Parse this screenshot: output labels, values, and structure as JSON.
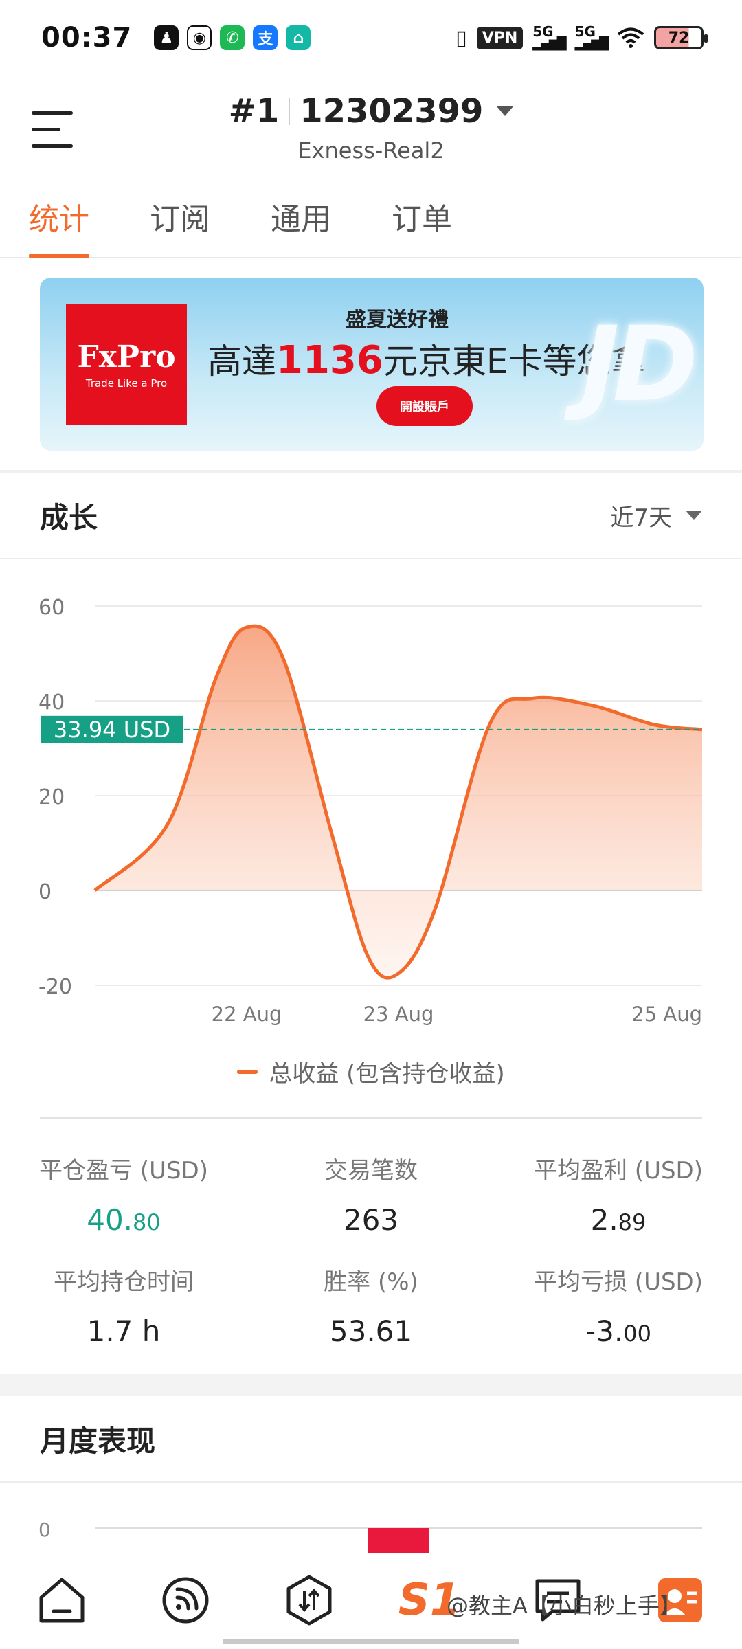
{
  "status_bar": {
    "time": "00:37",
    "vpn_label": "VPN",
    "network_1": "5G",
    "network_2": "5G",
    "battery": "72"
  },
  "header": {
    "rank": "#1",
    "account_number": "12302399",
    "server": "Exness-Real2"
  },
  "tabs": [
    {
      "label": "统计",
      "active": true
    },
    {
      "label": "订阅",
      "active": false
    },
    {
      "label": "通用",
      "active": false
    },
    {
      "label": "订单",
      "active": false
    }
  ],
  "banner": {
    "brand": "FxPro",
    "brand_tagline": "Trade Like a Pro",
    "headline_small": "盛夏送好禮",
    "headline_prefix": "高達",
    "headline_amount": "1136",
    "headline_suffix": "元京東E卡等您拿",
    "cta": "開設賬戶",
    "mark": "JD"
  },
  "growth": {
    "title": "成长",
    "range": "近7天",
    "current_value_label": "33.94 USD",
    "legend": "总收益 (包含持仓收益)"
  },
  "chart_data": {
    "type": "area",
    "series": [
      {
        "name": "总收益 (包含持仓收益)",
        "color": "#f26b2d",
        "points": [
          {
            "t": 0.0,
            "y": 0
          },
          {
            "t": 0.12,
            "y": 14
          },
          {
            "t": 0.2,
            "y": 45
          },
          {
            "t": 0.25,
            "y": 55.5
          },
          {
            "t": 0.31,
            "y": 49
          },
          {
            "t": 0.39,
            "y": 12
          },
          {
            "t": 0.45,
            "y": -14
          },
          {
            "t": 0.5,
            "y": -17.5
          },
          {
            "t": 0.56,
            "y": -4
          },
          {
            "t": 0.65,
            "y": 35
          },
          {
            "t": 0.72,
            "y": 40.5
          },
          {
            "t": 0.82,
            "y": 39
          },
          {
            "t": 0.92,
            "y": 35
          },
          {
            "t": 1.0,
            "y": 33.94
          }
        ]
      }
    ],
    "x_tick_labels": [
      "22 Aug",
      "23 Aug",
      "25 Aug"
    ],
    "x_tick_positions": [
      0.25,
      0.5,
      1.0
    ],
    "y_ticks": [
      60,
      40,
      20,
      0,
      -20
    ],
    "ylim": [
      -20,
      60
    ],
    "reference_line": {
      "value": 33.94,
      "label": "33.94 USD",
      "color": "#16a085"
    },
    "grid": true
  },
  "stats": [
    {
      "label": "平仓盈亏 (USD)",
      "int": "40.",
      "dec": "80",
      "positive": true
    },
    {
      "label": "交易笔数",
      "int": "263",
      "dec": "",
      "positive": false
    },
    {
      "label": "平均盈利 (USD)",
      "int": "2.",
      "dec": "89",
      "positive": false
    },
    {
      "label": "平均持仓时间",
      "int": "1.7 h",
      "dec": "",
      "positive": false
    },
    {
      "label": "胜率 (%)",
      "int": "53.61",
      "dec": "",
      "positive": false
    },
    {
      "label": "平均亏损 (USD)",
      "int": "-3.",
      "dec": "00",
      "positive": false
    }
  ],
  "monthly": {
    "title": "月度表现",
    "zero_label": "0"
  },
  "bottom_nav": {
    "icons": [
      "home-icon",
      "feed-icon",
      "trade-icon",
      "signal-icon",
      "message-icon",
      "profile-icon"
    ],
    "signal_label": "S1"
  },
  "watermark": "@教主A【小白秒上手】"
}
